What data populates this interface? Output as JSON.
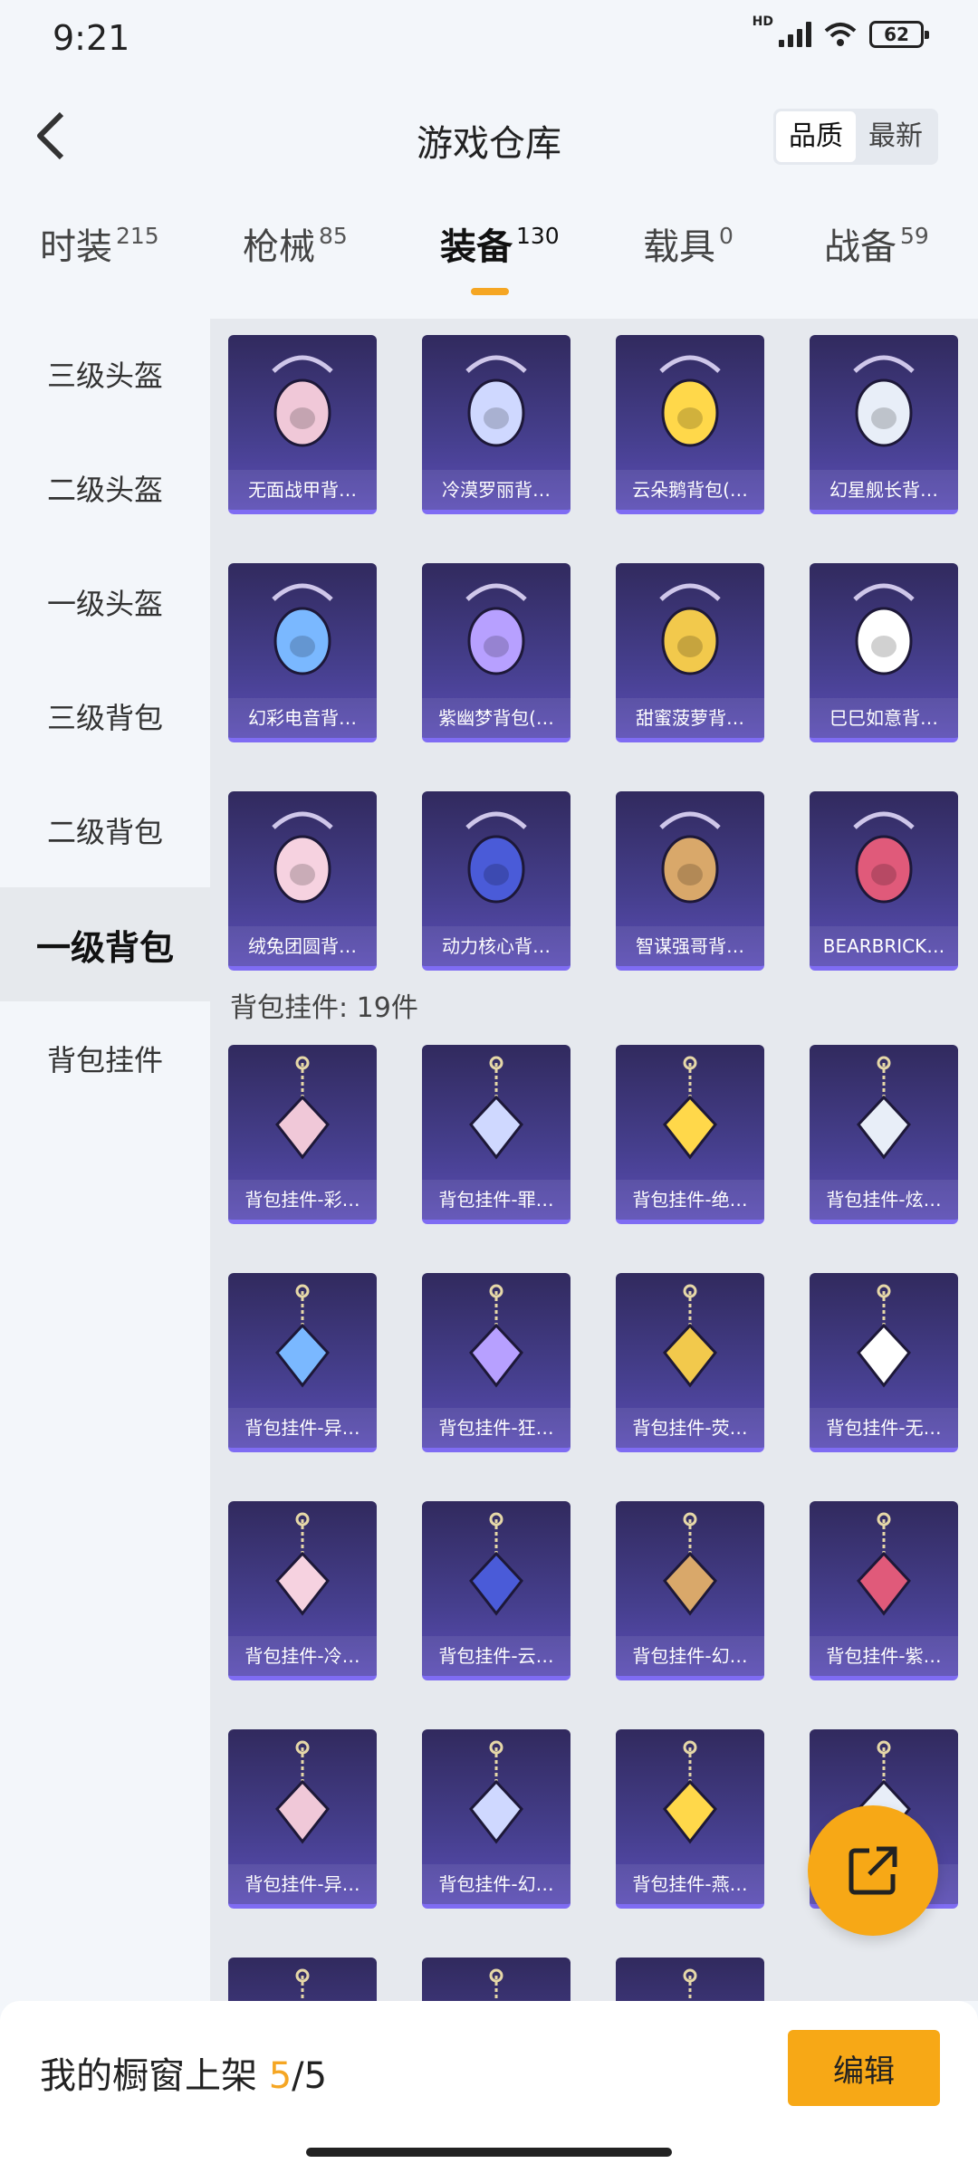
{
  "status": {
    "time": "9:21",
    "hd": "HD",
    "battery": "62"
  },
  "header": {
    "title": "游戏仓库",
    "sort_options": [
      {
        "label": "品质",
        "active": true
      },
      {
        "label": "最新",
        "active": false
      }
    ]
  },
  "tabs": [
    {
      "label": "时装",
      "count": "215"
    },
    {
      "label": "枪械",
      "count": "85"
    },
    {
      "label": "装备",
      "count": "130",
      "active": true
    },
    {
      "label": "载具",
      "count": "0"
    },
    {
      "label": "战备",
      "count": "59"
    }
  ],
  "sidebar": {
    "items": [
      {
        "label": "三级头盔"
      },
      {
        "label": "二级头盔"
      },
      {
        "label": "一级头盔"
      },
      {
        "label": "三级背包"
      },
      {
        "label": "二级背包"
      },
      {
        "label": "一级背包",
        "active": true
      },
      {
        "label": "背包挂件"
      }
    ]
  },
  "backpacks": [
    {
      "name": "无面战甲背…",
      "icon": "helmet-backpack"
    },
    {
      "name": "冷漠罗丽背…",
      "icon": "heart-backpack"
    },
    {
      "name": "云朵鹅背包(…",
      "icon": "flower-backpack"
    },
    {
      "name": "幻星舰长背…",
      "icon": "robot-backpack"
    },
    {
      "name": "幻彩电音背…",
      "icon": "speaker-backpack"
    },
    {
      "name": "紫幽梦背包(…",
      "icon": "bunny-backpack"
    },
    {
      "name": "甜蜜菠萝背…",
      "icon": "pineapple-backpack"
    },
    {
      "name": "巳巳如意背…",
      "icon": "bunny-white-backpack"
    },
    {
      "name": "绒兔团圆背…",
      "icon": "plush-bunny-backpack"
    },
    {
      "name": "动力核心背…",
      "icon": "core-backpack"
    },
    {
      "name": "智谋强哥背…",
      "icon": "potato-backpack"
    },
    {
      "name": "BEARBRICK…",
      "icon": "bearbrick-backpack"
    }
  ],
  "section": {
    "label": "背包挂件: 19件"
  },
  "charms": [
    {
      "name": "背包挂件-彩…",
      "icon": "ice-cream-charm"
    },
    {
      "name": "背包挂件-罪…",
      "icon": "winged-heart-charm"
    },
    {
      "name": "背包挂件-绝…",
      "icon": "camera-charm"
    },
    {
      "name": "背包挂件-炫…",
      "icon": "candy-charm"
    },
    {
      "name": "背包挂件-异…",
      "icon": "bells-charm"
    },
    {
      "name": "背包挂件-狂…",
      "icon": "feather-charm"
    },
    {
      "name": "背包挂件-荧…",
      "icon": "mask-charm"
    },
    {
      "name": "背包挂件-无…",
      "icon": "crystal-charm"
    },
    {
      "name": "背包挂件-冷…",
      "icon": "rose-charm"
    },
    {
      "name": "背包挂件-云…",
      "icon": "goose-charm"
    },
    {
      "name": "背包挂件-幻…",
      "icon": "robot-charm"
    },
    {
      "name": "背包挂件-紫…",
      "icon": "bell-flower-charm"
    },
    {
      "name": "背包挂件-异…",
      "icon": "wings-emblem-charm"
    },
    {
      "name": "背包挂件-幻…",
      "icon": "potion-charm"
    },
    {
      "name": "背包挂件-燕…",
      "icon": "swallow-charm"
    },
    {
      "name": "",
      "icon": "cat-charm"
    },
    {
      "name": "",
      "icon": "ring-charm"
    },
    {
      "name": "",
      "icon": "clip-charm"
    },
    {
      "name": "",
      "icon": "pearl-charm"
    }
  ],
  "bottom": {
    "showcase_prefix": "我的橱窗上架 ",
    "showcase_current": "5",
    "showcase_total": "/5",
    "edit_label": "编辑"
  },
  "colors": {
    "accent": "#f7a816",
    "card_bg": "#3f3880",
    "card_edge": "#7f6cf3"
  }
}
